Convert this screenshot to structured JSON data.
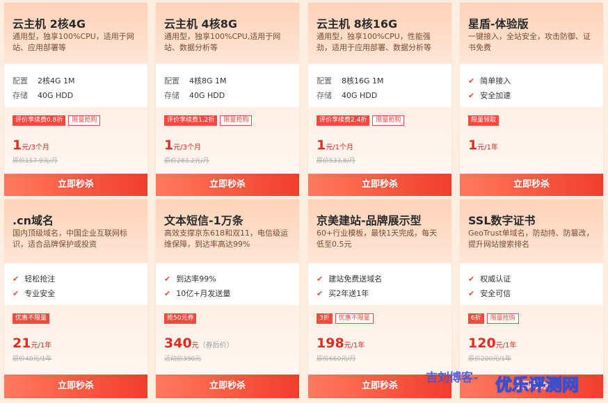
{
  "cards": [
    {
      "title": "云主机 2核4G",
      "desc": "通用型，独享100%CPU，适用于网站、应用部署等",
      "spec1_k": "配置",
      "spec1_v": "2核4G 1M",
      "spec2_k": "存储",
      "spec2_v": "40G HDD",
      "badge1": "评价享续费0.8折",
      "badge2": "限量抢购",
      "price": "1",
      "unit": "元/3个月",
      "note": "",
      "orig": "原价157.9元/月",
      "button": "立即秒杀"
    },
    {
      "title": "云主机 4核8G",
      "desc": "通用型，独享100%CPU,适用于网站、数据分析等",
      "spec1_k": "配置",
      "spec1_v": "4核8G 1M",
      "spec2_k": "存储",
      "spec2_v": "40G HDD",
      "badge1": "评价享续费1.2折",
      "badge2": "限量抢购",
      "price": "1",
      "unit": "元/3个月",
      "note": "",
      "orig": "原价283.2元/月",
      "button": "立即秒杀"
    },
    {
      "title": "云主机 8核16G",
      "desc": "通用型，独享100%CPU，性能强劲，适用于应用部署、数据分析等",
      "spec1_k": "配置",
      "spec1_v": "8核16G 1M",
      "spec2_k": "存储",
      "spec2_v": "40G HDD",
      "badge1": "评价享续费2.4折",
      "badge2": "限量抢购",
      "price": "1",
      "unit": "元/1个月",
      "note": "",
      "orig": "原价533.8/月",
      "button": "立即秒杀"
    },
    {
      "title": "星盾-体验版",
      "desc": "一键接入，全站安全，攻击防御、证书免费",
      "feat1": "简单接入",
      "feat2": "安全加速",
      "badge1": "限量领取",
      "badge2": "",
      "price": "1",
      "unit": "元/1年",
      "note": "",
      "orig": "",
      "button": "立即秒杀"
    },
    {
      "title": ".cn域名",
      "desc": "国内顶级域名，中国企业互联网标识，适合品牌保护或投资",
      "feat1": "轻松抢注",
      "feat2": "专业安全",
      "badge1": "优惠不限量",
      "badge2": "",
      "price": "21",
      "unit": "元/1年",
      "note": "",
      "orig": "原价40元/1年",
      "button": "立即秒杀"
    },
    {
      "title": "文本短信-1万条",
      "desc": "高效支撑京东618和双11，电信级运维保障，到达率高达99%",
      "feat1": "到达率99%",
      "feat2": "10亿+月发送量",
      "badge1": "抢50元券",
      "badge2": "",
      "price": "340",
      "unit": "元",
      "note": "（券后价）",
      "orig": "活动价390元",
      "button": "立即秒杀"
    },
    {
      "title": "京美建站-品牌展示型",
      "desc": "60+行业模板，最快1天完成，每天低至0.5元",
      "feat1": "建站免费送域名",
      "feat2": "买2年送1年",
      "badge1": "3折",
      "badge2": "优惠不限量",
      "price": "198",
      "unit": "元/1年",
      "note": "",
      "orig": "原价660元/月",
      "button": "立即秒杀"
    },
    {
      "title": "SSL数字证书",
      "desc": "GeoTrust单域名，防劫持、防篡改，提升网站搜索排名",
      "feat1": "权威认证",
      "feat2": "安全可信",
      "badge1": "6折",
      "badge2": "限量抢购",
      "price": "120",
      "unit": "元/1年",
      "note": "",
      "orig": "原价200元/1年",
      "button": "立即秒杀"
    }
  ],
  "watermark": {
    "blog": "吉刘博客-",
    "brand": "优乐评测网"
  }
}
